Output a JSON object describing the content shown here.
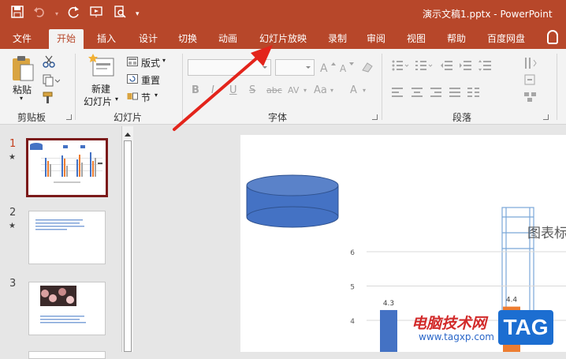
{
  "window": {
    "doc_title": "演示文稿1.pptx  -  PowerPoint"
  },
  "qat": {
    "save_icon": "save-icon",
    "undo_icon": "undo-icon",
    "redo_icon": "redo-icon",
    "present_icon": "present-icon",
    "preview_icon": "print-preview-icon",
    "customize_icon": "customize-icon"
  },
  "tabs": [
    "文件",
    "开始",
    "插入",
    "设计",
    "切换",
    "动画",
    "幻灯片放映",
    "录制",
    "审阅",
    "视图",
    "帮助",
    "百度网盘"
  ],
  "active_tab": "开始",
  "ribbon": {
    "clipboard": {
      "paste": "粘贴",
      "label": "剪贴板"
    },
    "slides": {
      "new_slide_line1": "新建",
      "new_slide_line2": "幻灯片",
      "layout": "版式",
      "reset": "重置",
      "section": "节",
      "label": "幻灯片"
    },
    "font": {
      "label": "字体",
      "bold": "B",
      "italic": "I",
      "underline": "U",
      "strike": "S",
      "shadow": "abc",
      "spacing": "AV",
      "case": "Aa",
      "color": "A"
    },
    "paragraph": {
      "label": "段落"
    }
  },
  "slides": [
    {
      "number": "1",
      "star": "★"
    },
    {
      "number": "2",
      "star": "★"
    },
    {
      "number": "3",
      "star": ""
    }
  ],
  "slide_content": {
    "chart_title": "图表标",
    "y_ticks": [
      "6",
      "5",
      "4"
    ],
    "data_labels": [
      "4.3",
      "4.4"
    ]
  },
  "chart_data": {
    "type": "bar",
    "title": "图表标",
    "y_ticks": [
      4,
      5,
      6
    ],
    "series": [
      {
        "values": [
          4.3
        ],
        "color": "#4472c4"
      },
      {
        "values": [
          4.4
        ],
        "color": "#ed7d31"
      }
    ]
  },
  "watermark": {
    "text": "电脑技术网",
    "url": "www.tagxp.com",
    "badge": "TAG"
  },
  "colors": {
    "accent": "#b7472a",
    "selected_slide_border": "#7b1a1a",
    "arrow": "#e3241b"
  }
}
